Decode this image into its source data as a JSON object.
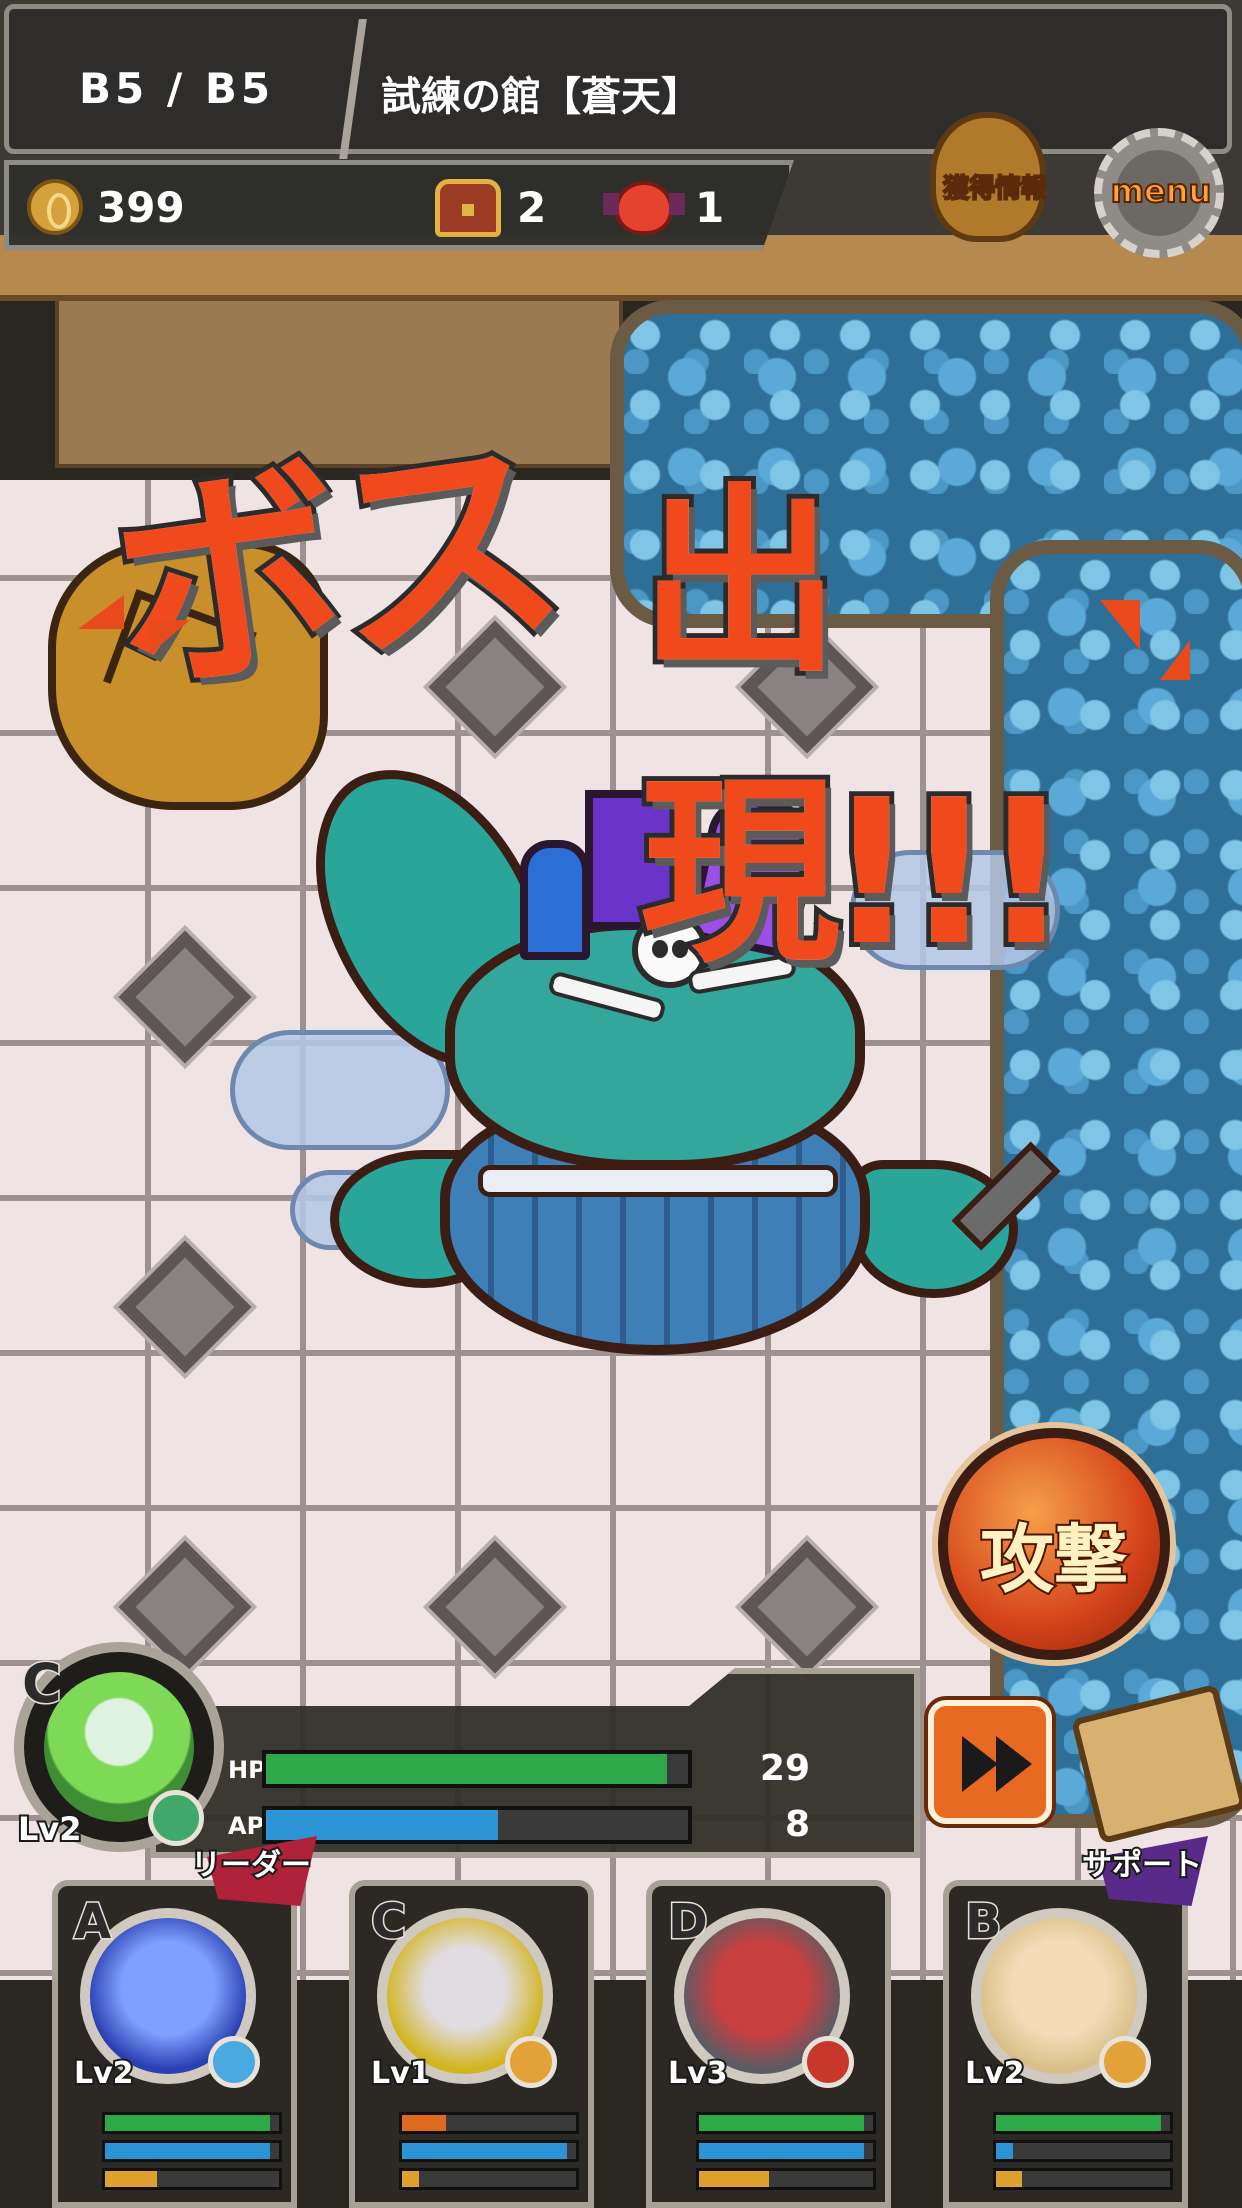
{
  "header": {
    "floor": "B5  /  B5",
    "dungeon": "試練の館【蒼天】",
    "coins": "399",
    "chests": "2",
    "enemies": "1"
  },
  "buttons": {
    "loot_info": "獲得情報",
    "menu": "menu",
    "attack": "攻撃"
  },
  "banner": {
    "part1": "ボス",
    "part2": "出現!!!"
  },
  "leader": {
    "rank": "C",
    "level": "Lv2",
    "hp_label": "HP",
    "ap_label": "AP",
    "hp": "29",
    "ap": "8",
    "hp_ratio": 0.95,
    "ap_ratio": 0.55
  },
  "party": [
    {
      "rank": "A",
      "level": "Lv2",
      "tag": "リーダー",
      "hp": 0.95,
      "ap": 0.95,
      "xp": 0.3
    },
    {
      "rank": "C",
      "level": "Lv1",
      "tag": "",
      "hp": 0.25,
      "ap": 0.95,
      "xp": 0.1
    },
    {
      "rank": "D",
      "level": "Lv3",
      "tag": "",
      "hp": 0.95,
      "ap": 0.95,
      "xp": 0.4
    },
    {
      "rank": "B",
      "level": "Lv2",
      "tag": "サポート",
      "hp": 0.95,
      "ap": 0.1,
      "xp": 0.15
    }
  ],
  "colors": {
    "hp": "#2fa84a",
    "ap": "#2b93d6",
    "xp": "#e0a030",
    "hp_low": "#e06a1e"
  },
  "icons": {
    "coin": "coin-icon",
    "chest": "treasure-chest-icon",
    "enemy": "imp-enemy-icon",
    "loot": "money-bag-icon",
    "menu": "gear-icon",
    "fast_forward": "fast-forward-icon",
    "map": "map-scroll-icon"
  }
}
